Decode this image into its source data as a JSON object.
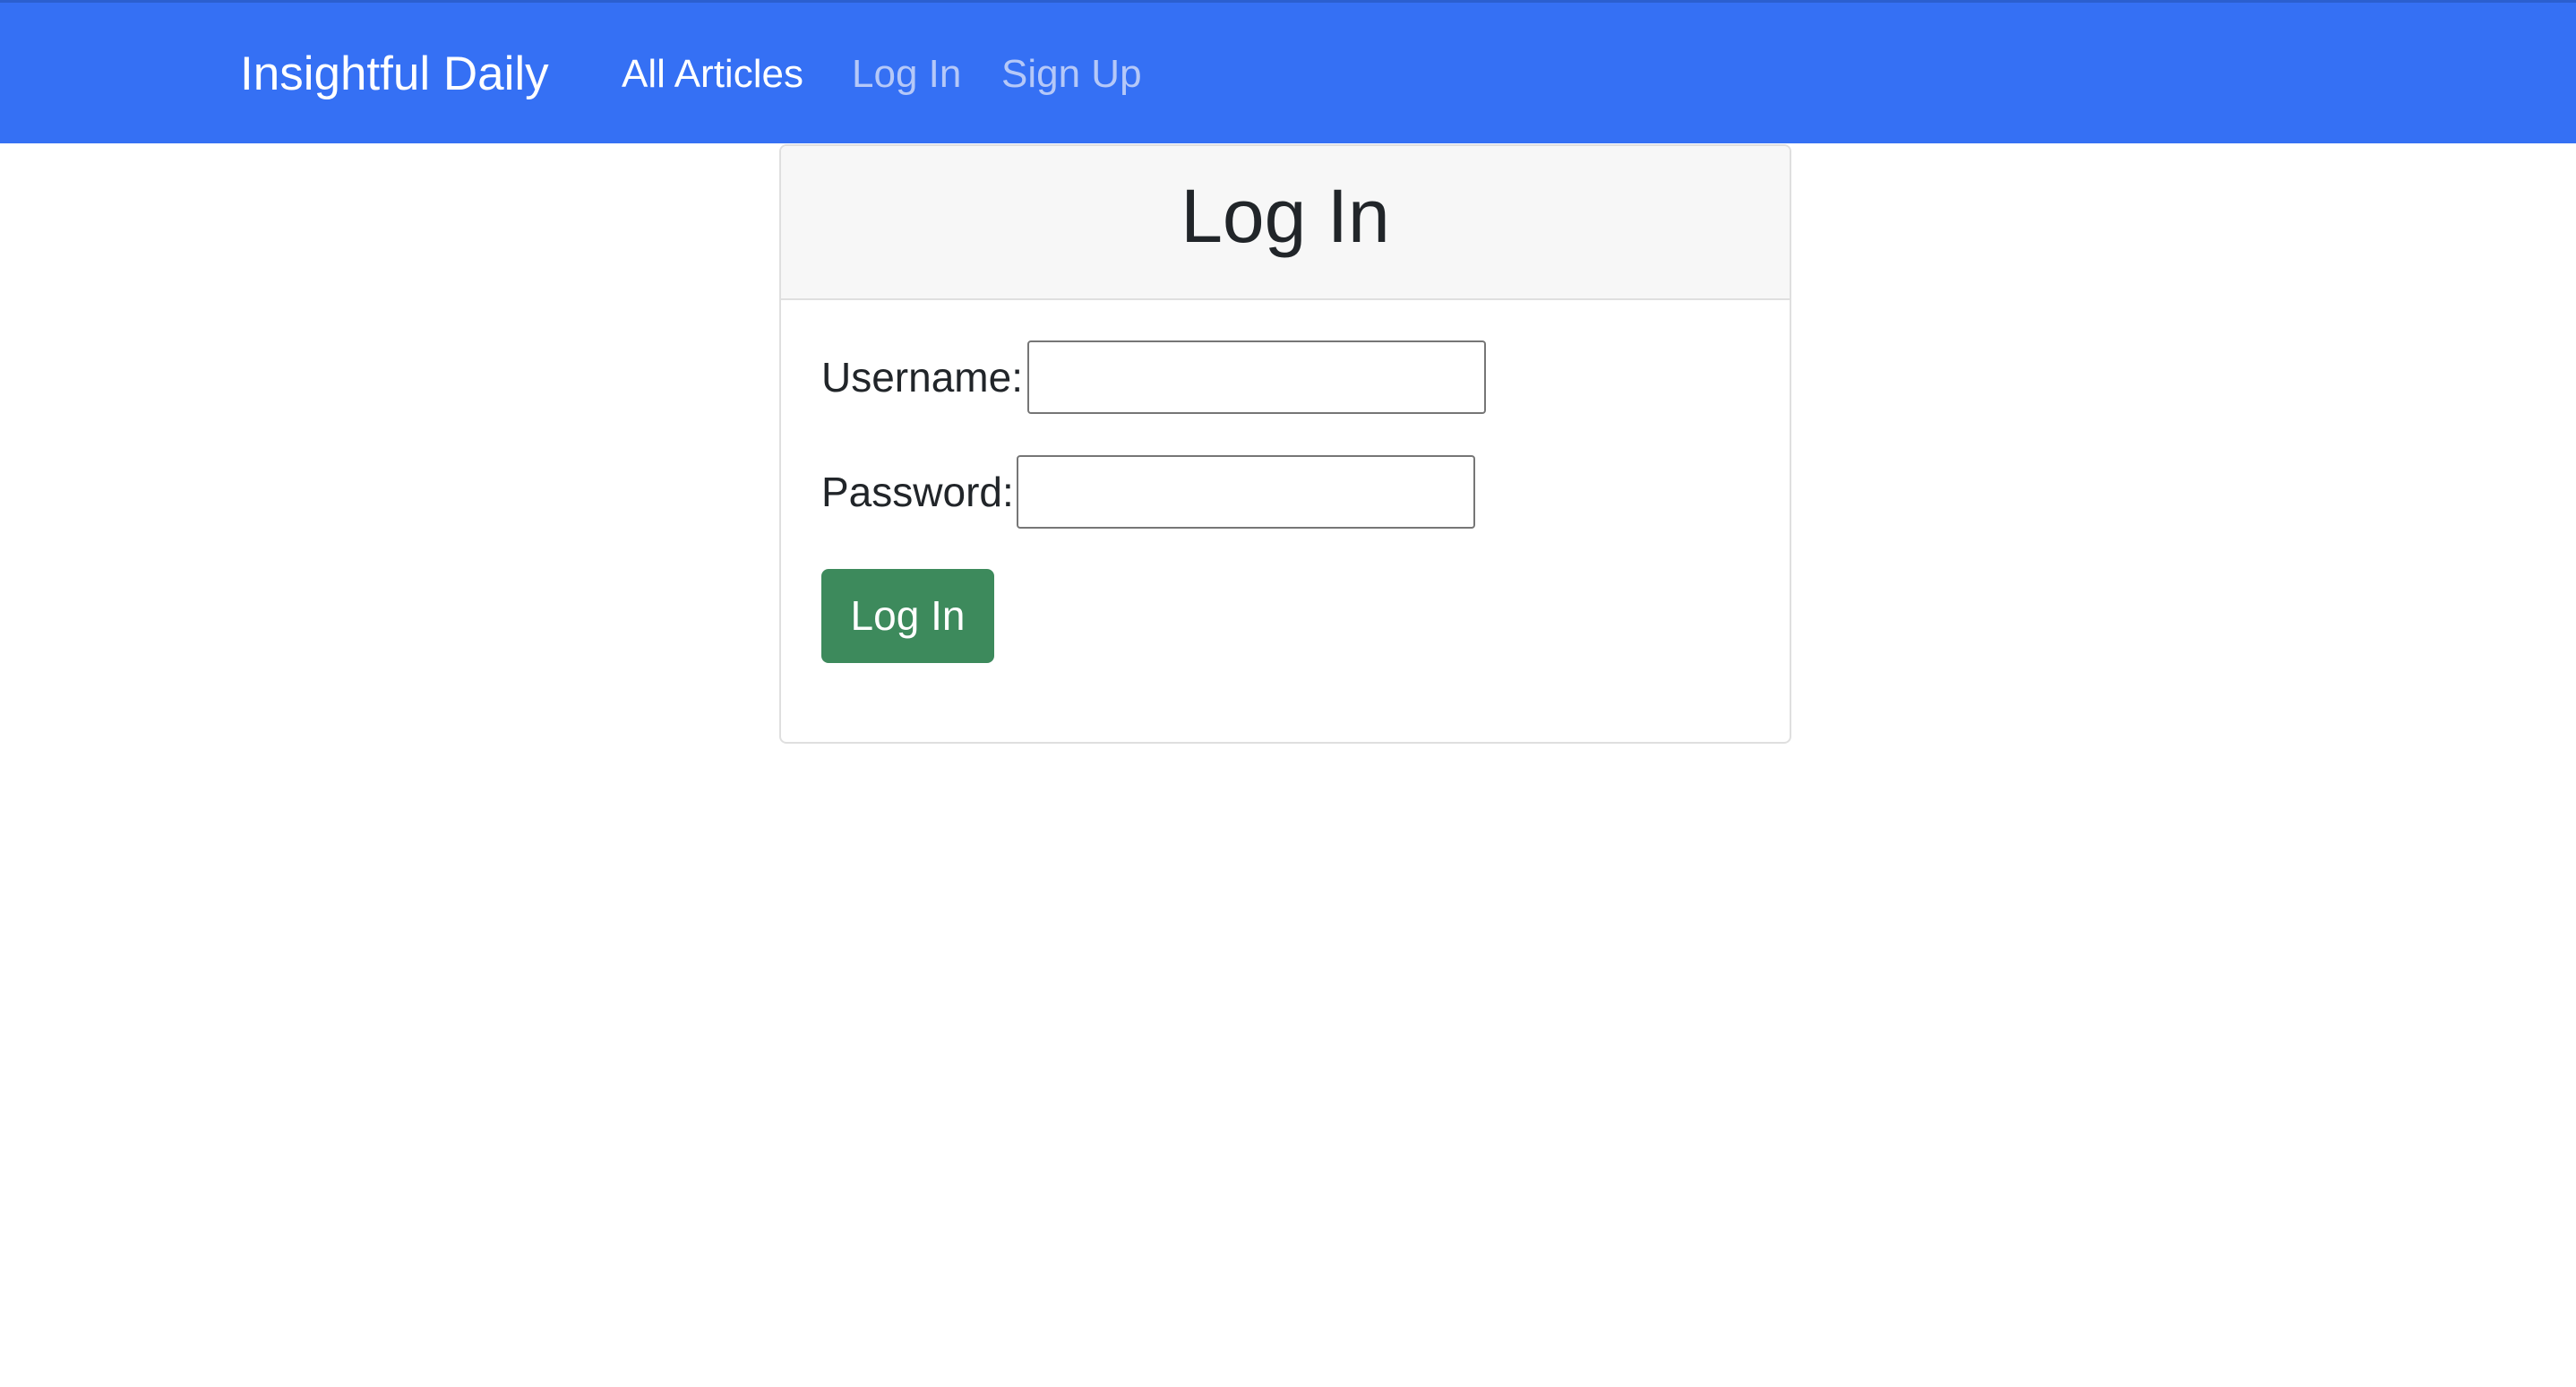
{
  "navbar": {
    "brand": "Insightful Daily",
    "links": [
      {
        "label": "All Articles"
      },
      {
        "label": "Log In"
      },
      {
        "label": "Sign Up"
      }
    ],
    "colors": {
      "background": "#3570f4",
      "active_link": "#ffffff",
      "muted_link": "#b5c8f8"
    }
  },
  "login_card": {
    "title": "Log In",
    "username": {
      "label": "Username:",
      "value": "",
      "placeholder": ""
    },
    "password": {
      "label": "Password:",
      "value": "",
      "placeholder": ""
    },
    "submit_label": "Log In",
    "colors": {
      "header_background": "#f7f7f7",
      "submit_button": "#3d8a5c"
    }
  }
}
